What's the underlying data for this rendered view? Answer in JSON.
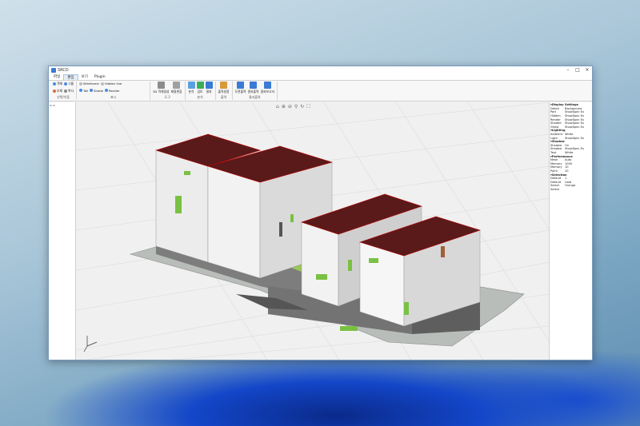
{
  "window": {
    "title": "SRCD"
  },
  "tabs": [
    "파일",
    "편집",
    "보기",
    "Plugin"
  ],
  "ribbon": {
    "group1": {
      "label": "선택/이동",
      "items": [
        "객체",
        "그룹",
        "부재",
        "복사"
      ]
    },
    "group2": {
      "label": "표시",
      "items": [
        "Wireframe",
        "Hidden line",
        "Tail",
        "Shade",
        "Render"
      ]
    },
    "group3": {
      "label": "도구",
      "items": [
        "3D 객체생성",
        "재질편집"
      ]
    },
    "group4": {
      "label": "분석",
      "items": [
        "분석",
        "검토",
        "결과"
      ]
    },
    "group5": {
      "label": "출력",
      "items": [
        "출력설정"
      ]
    },
    "group6": {
      "label": "결과출력",
      "items": [
        "도면출력",
        "결과출력",
        "결과보고서"
      ]
    }
  },
  "colors": {
    "roof": "#5a1a1a",
    "wall": "#ececec",
    "gray_block": "#8a8a8a",
    "window": "#7ac143",
    "ground": "#b9bdb9",
    "courtyard": "#9bc55a"
  },
  "right_panel": {
    "rows": [
      {
        "type": "section",
        "text": "Display Settings"
      },
      {
        "type": "row",
        "label": "Detail",
        "value": "Background"
      },
      {
        "type": "row",
        "label": "Part",
        "value": "ShowSpec Ex"
      },
      {
        "type": "row",
        "label": "Hidden",
        "value": "ShowSpec Ex"
      },
      {
        "type": "row",
        "label": "Render",
        "value": "ShowSpec Ex"
      },
      {
        "type": "row",
        "label": "Shaded",
        "value": "ShowSpec Ex"
      },
      {
        "type": "row",
        "label": "Ghost",
        "value": "ShowSpec Ex"
      },
      {
        "type": "section",
        "text": "Lighting"
      },
      {
        "type": "row",
        "label": "Ambient",
        "value": "White"
      },
      {
        "type": "row",
        "label": "Light",
        "value": "ShowSpec Ex"
      },
      {
        "type": "section",
        "text": "Shadow"
      },
      {
        "type": "row",
        "label": "Shadow",
        "value": "On"
      },
      {
        "type": "row",
        "label": "Shadow",
        "value": "ShowSpec Ex"
      },
      {
        "type": "row",
        "label": "Text",
        "value": "White"
      },
      {
        "type": "section",
        "text": "Performance"
      },
      {
        "type": "row",
        "label": "Mesh",
        "value": "Auto"
      },
      {
        "type": "row",
        "label": "Memory",
        "value": "1000"
      },
      {
        "type": "row",
        "label": "Memory",
        "value": "10"
      },
      {
        "type": "row",
        "label": "Point",
        "value": "10"
      },
      {
        "type": "section",
        "text": "Selection"
      },
      {
        "type": "row",
        "label": "Default",
        "value": "1"
      },
      {
        "type": "row",
        "label": "Default",
        "value": "Gold"
      },
      {
        "type": "row",
        "label": "Select",
        "value": "Orange"
      },
      {
        "type": "row",
        "label": "Select",
        "value": ""
      }
    ]
  }
}
